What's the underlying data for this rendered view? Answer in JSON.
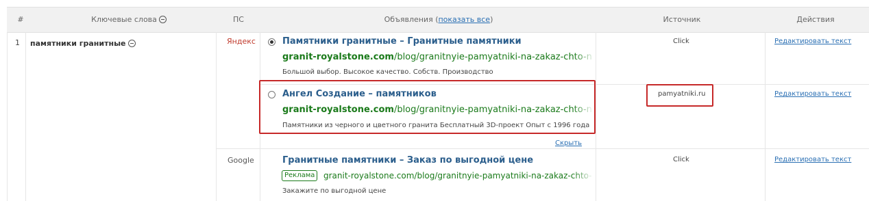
{
  "header": {
    "num": "#",
    "keywords": "Ключевые слова",
    "ps": "ПС",
    "ads_prefix": "Объявления (",
    "ads_link": "показать все",
    "ads_suffix": ")",
    "source": "Источник",
    "actions": "Действия"
  },
  "row": {
    "number": "1",
    "keyword": "памятники гранитные"
  },
  "search_engines": {
    "yandex": "Яндекс",
    "google": "Google"
  },
  "ads": [
    {
      "selected": true,
      "title": "Памятники гранитные – Гранитные памятники",
      "domain": "granit-royalstone.com",
      "path": "/blog/granitnyie-pamyatniki-na-zakaz-chto-nuzhno-znat-klie",
      "desc": "Большой выбор. Высокое качество. Собств. Производство",
      "source": "Click",
      "action": "Редактировать текст"
    },
    {
      "selected": false,
      "title": "Ангел Создание – памятников",
      "domain": "granit-royalstone.com",
      "path": "/blog/granitnyie-pamyatniki-na-zakaz-chto-nuzhno-znat-klie",
      "desc": "Памятники из черного и цветного гранита Бесплатный 3D-проект Опыт с 1996 года",
      "source": "pamyatniki.ru",
      "action": "Редактировать текст"
    },
    {
      "title": "Гранитные памятники – Заказ по выгодной цене",
      "badge": "Реклама",
      "url": "granit-royalstone.com/blog/granitnyie-pamyatniki-na-zakaz-chto-nuzhno-z",
      "desc": "Закажите по выгодной цене",
      "source": "Click",
      "action": "Редактировать текст"
    }
  ],
  "hide_label": "Скрыть",
  "colors": {
    "highlight": "#c62828",
    "link": "#2a6fb3",
    "url_green": "#1a7a1a",
    "title_blue": "#2b5e8c"
  }
}
